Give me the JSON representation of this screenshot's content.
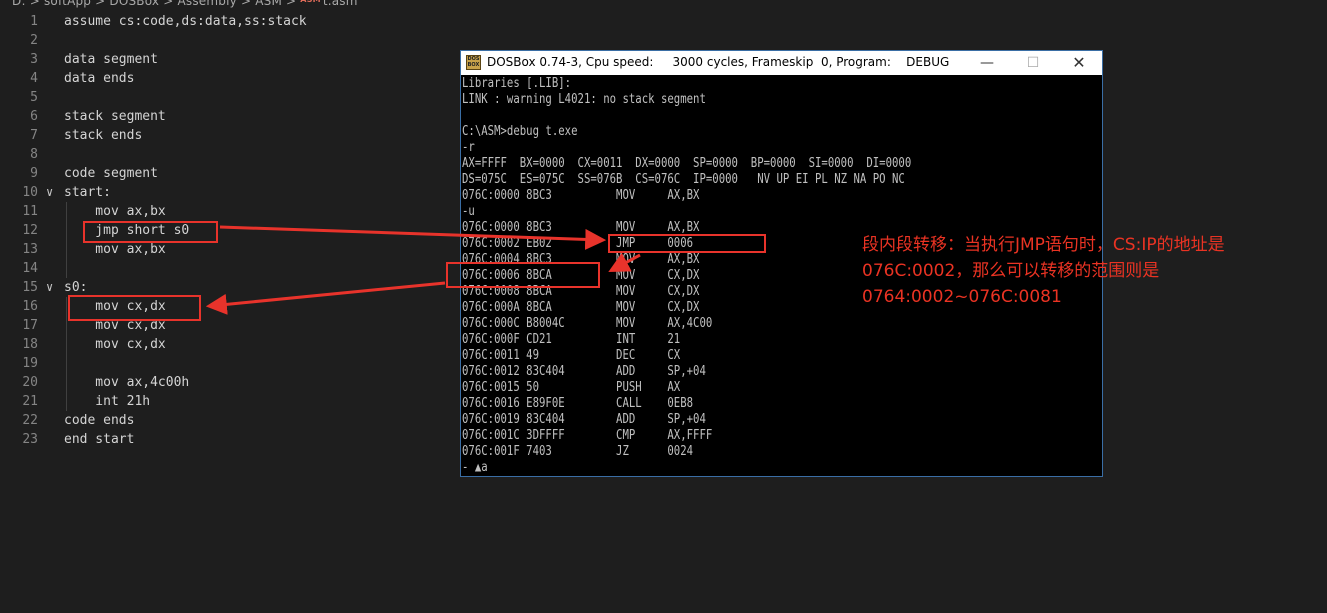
{
  "breadcrumb": {
    "path": "D: > softApp > DOSBox > Assembly > ASM >",
    "file_icon": "ASM",
    "file": "t.asm"
  },
  "editor": {
    "lines": [
      {
        "n": "1",
        "text": "assume cs:code,ds:data,ss:stack"
      },
      {
        "n": "2",
        "text": ""
      },
      {
        "n": "3",
        "text": "data segment"
      },
      {
        "n": "4",
        "text": "data ends"
      },
      {
        "n": "5",
        "text": ""
      },
      {
        "n": "6",
        "text": "stack segment"
      },
      {
        "n": "7",
        "text": "stack ends"
      },
      {
        "n": "8",
        "text": ""
      },
      {
        "n": "9",
        "text": "code segment"
      },
      {
        "n": "10",
        "text": "start:",
        "fold": "chevron-down"
      },
      {
        "n": "11",
        "text": "    mov ax,bx"
      },
      {
        "n": "12",
        "text": "    jmp short s0"
      },
      {
        "n": "13",
        "text": "    mov ax,bx"
      },
      {
        "n": "14",
        "text": ""
      },
      {
        "n": "15",
        "text": "s0:",
        "fold": "chevron-down"
      },
      {
        "n": "16",
        "text": "    mov cx,dx"
      },
      {
        "n": "17",
        "text": "    mov cx,dx"
      },
      {
        "n": "18",
        "text": "    mov cx,dx"
      },
      {
        "n": "19",
        "text": ""
      },
      {
        "n": "20",
        "text": "    mov ax,4c00h"
      },
      {
        "n": "21",
        "text": "    int 21h"
      },
      {
        "n": "22",
        "text": "code ends"
      },
      {
        "n": "23",
        "text": "end start"
      }
    ]
  },
  "dosbox": {
    "title": "DOSBox 0.74-3, Cpu speed:     3000 cycles, Frameskip  0, Program:    DEBUG",
    "icon_text": "DOS BOX",
    "console_lines": [
      "Libraries [.LIB]:",
      "LINK : warning L4021: no stack segment",
      "",
      "C:\\ASM>debug t.exe",
      "-r",
      "AX=FFFF  BX=0000  CX=0011  DX=0000  SP=0000  BP=0000  SI=0000  DI=0000",
      "DS=075C  ES=075C  SS=076B  CS=076C  IP=0000   NV UP EI PL NZ NA PO NC",
      "076C:0000 8BC3          MOV     AX,BX",
      "-u",
      "076C:0000 8BC3          MOV     AX,BX",
      "076C:0002 EB02          JMP     0006",
      "076C:0004 8BC3          MOV     AX,BX",
      "076C:0006 8BCA          MOV     CX,DX",
      "076C:0008 8BCA          MOV     CX,DX",
      "076C:000A 8BCA          MOV     CX,DX",
      "076C:000C B8004C        MOV     AX,4C00",
      "076C:000F CD21          INT     21",
      "076C:0011 49            DEC     CX",
      "076C:0012 83C404        ADD     SP,+04",
      "076C:0015 50            PUSH    AX",
      "076C:0016 E89F0E        CALL    0EB8",
      "076C:0019 83C404        ADD     SP,+04",
      "076C:001C 3DFFFF        CMP     AX,FFFF",
      "076C:001F 7403          JZ      0024",
      "- ▲a"
    ]
  },
  "annotation": {
    "lines": [
      "段内段转移：当执行JMP语句时，CS:IP的地址是",
      "076C:0002，那么可以转移的范围则是",
      "0764:0002~076C:0081"
    ]
  },
  "colors": {
    "background": "#1e1e1e",
    "line_number": "#858585",
    "code_text": "#d4d4d4",
    "console_text": "#c0c0c0",
    "highlight_red": "#e8332b"
  }
}
